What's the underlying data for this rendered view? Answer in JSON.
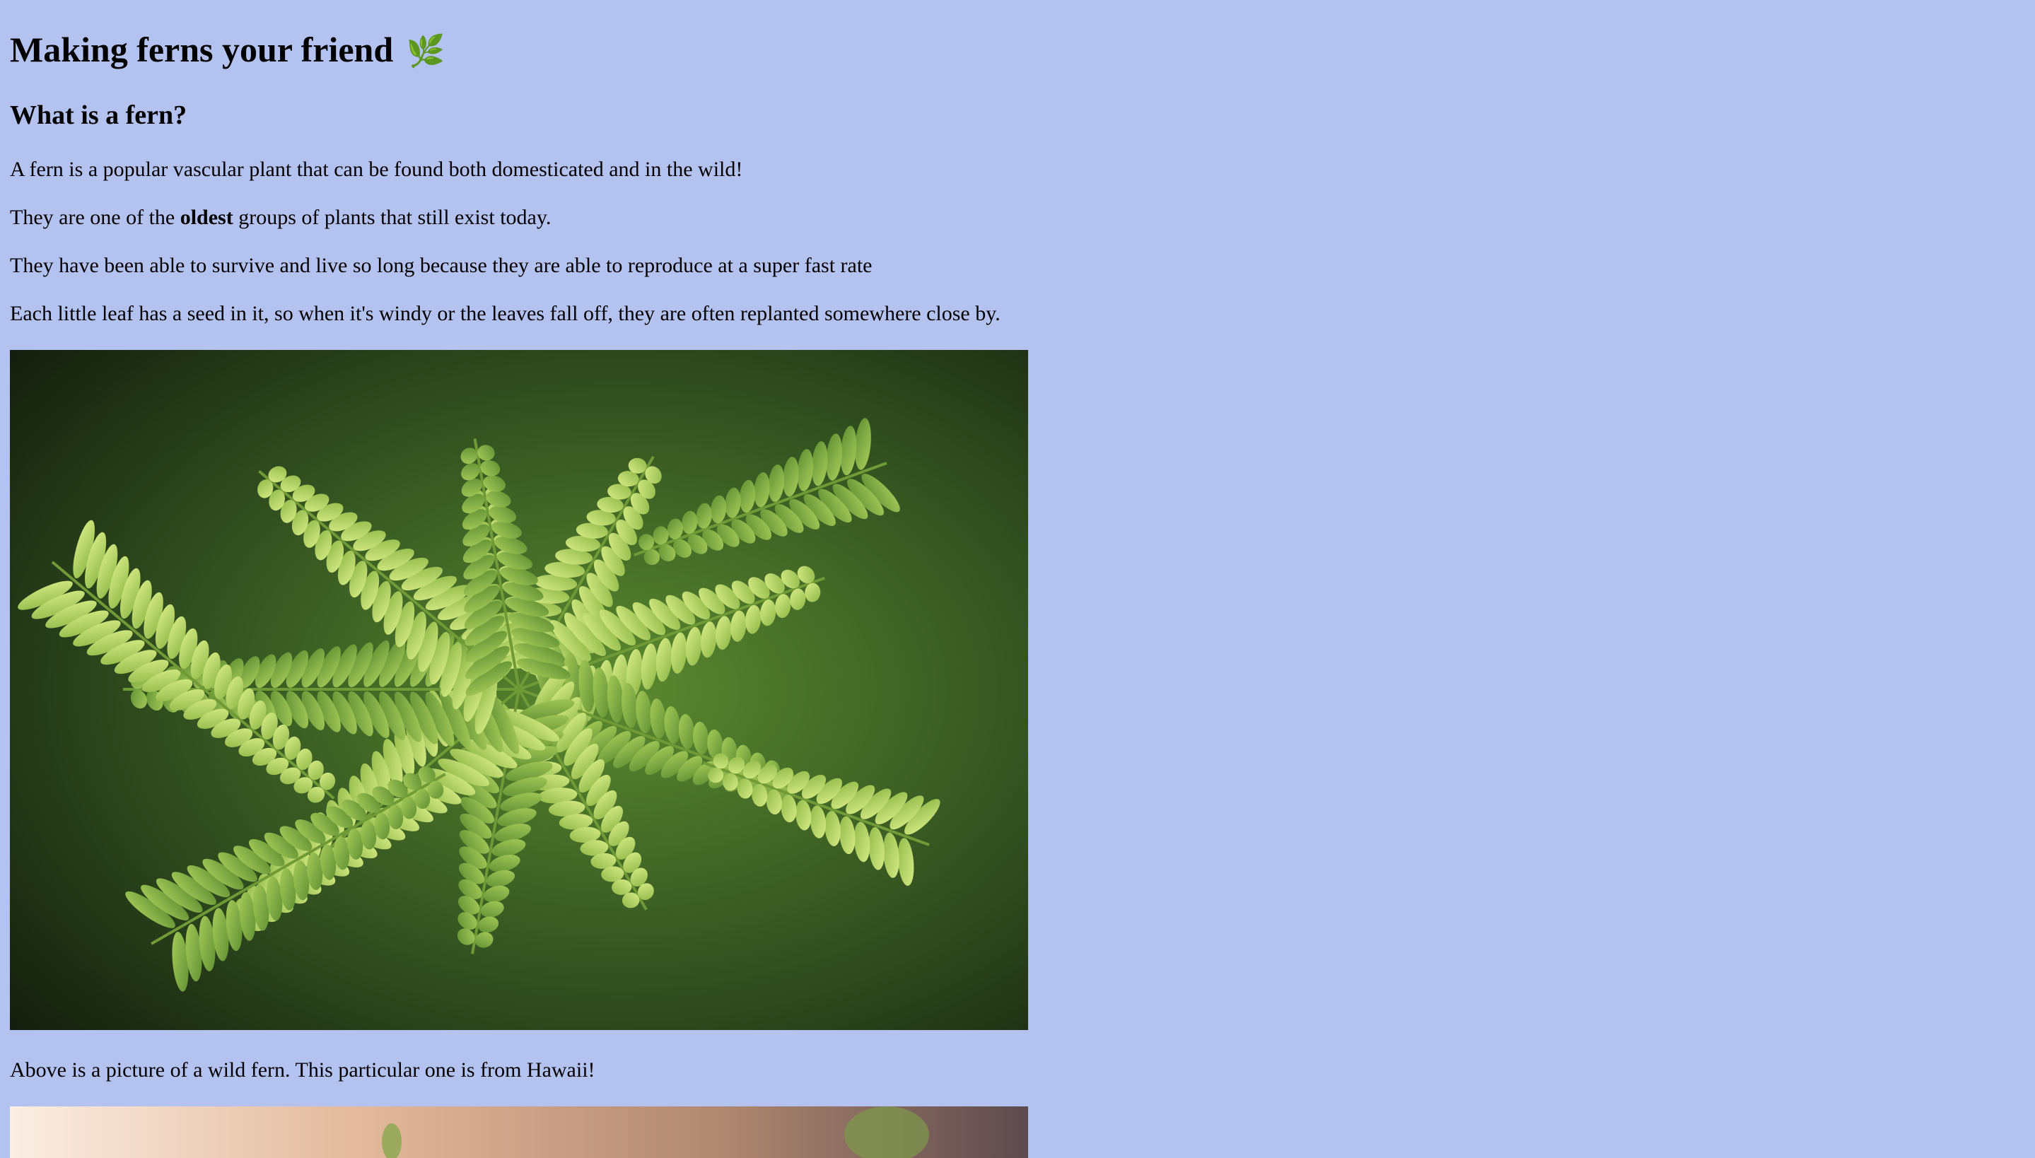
{
  "page": {
    "title": "Making ferns your friend",
    "title_icon": "leaf-icon",
    "heading": "What is a fern?",
    "p1": "A fern is a popular vascular plant that can be found both domesticated and in the wild!",
    "p2_before": "They are one of the ",
    "p2_bold": "oldest",
    "p2_after": " groups of plants that still exist today.",
    "p3": "They have been able to survive and live so long because they are able to reproduce at a super fast rate",
    "p4": "Each little leaf has a seed in it, so when it's windy or the leaves fall off, they are often replanted somewhere close by.",
    "caption": "Above is a picture of a wild fern. This particular one is from Hawaii!"
  },
  "colors": {
    "background": "#b4c2ef",
    "fern_light": "#c8e070",
    "fern_mid": "#8fb848",
    "fern_dark": "#3f6a2a",
    "shadow": "#1a2414"
  }
}
